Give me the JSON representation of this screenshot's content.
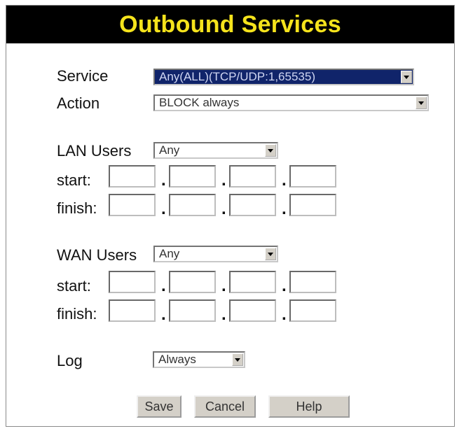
{
  "title": "Outbound Services",
  "service": {
    "label": "Service",
    "value": "Any(ALL)(TCP/UDP:1,65535)"
  },
  "action": {
    "label": "Action",
    "value": "BLOCK always"
  },
  "lan": {
    "label": "LAN Users",
    "value": "Any",
    "start_label": "start:",
    "finish_label": "finish:"
  },
  "wan": {
    "label": "WAN Users",
    "value": "Any",
    "start_label": "start:",
    "finish_label": "finish:"
  },
  "log": {
    "label": "Log",
    "value": "Always"
  },
  "buttons": {
    "save": "Save",
    "cancel": "Cancel",
    "help": "Help"
  },
  "ip_separator": ".",
  "colors": {
    "title_bg": "#000000",
    "title_text": "#f5e31c",
    "selected_bg": "#10246a",
    "button_face": "#d4d0c8"
  }
}
